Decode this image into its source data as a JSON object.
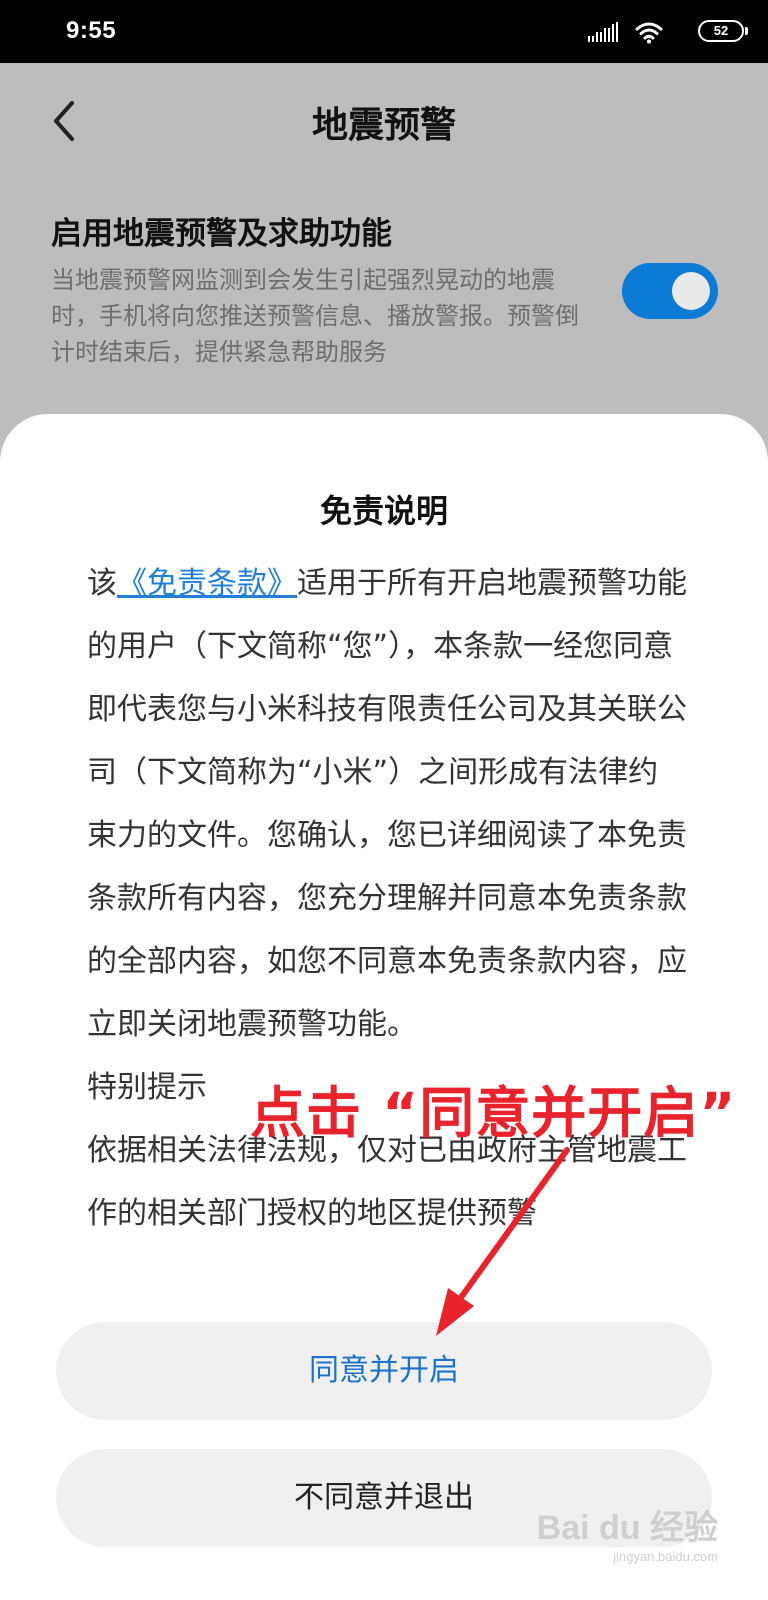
{
  "status_bar": {
    "time": "9:55",
    "battery": "52",
    "icons": [
      "signal-icon",
      "wifi-icon",
      "battery-icon"
    ]
  },
  "header": {
    "back_icon": "chevron-left-icon",
    "title": "地震预警"
  },
  "setting": {
    "title": "启用地震预警及求助功能",
    "description": "当地震预警网监测到会发生引起强烈晃动的地震时，手机将向您推送预警信息、播放警报。预警倒计时结束后，提供紧急帮助服务",
    "toggle_on": true,
    "toggle_color": "#0c7bd6"
  },
  "dialog": {
    "title": "免责说明",
    "para1_prefix": "该",
    "para1_link": "《免责条款》",
    "para1_rest": "适用于所有开启地震预警功能的用户（下文简称“您”），本条款一经您同意即代表您与小米科技有限责任公司及其关联公司（下文简称为“小米”）之间形成有法律约束力的文件。您确认，您已详细阅读了本免责条款所有内容，您充分理解并同意本免责条款的全部内容，如您不同意本免责条款内容，应立即关闭地震预警功能。",
    "para2": "特别提示",
    "para3": "依据相关法律法规，仅对已由政府主管地震工作的相关部门授权的地区提供预警",
    "agree_button": "同意并开启",
    "exit_button": "不同意并退出",
    "link_color": "#1f7fd8"
  },
  "annotation": {
    "text": "点击 “同意并开启”",
    "color": "#e8232c"
  },
  "watermark": {
    "brand": "Bai du 经验",
    "url": "jingyan.baidu.com"
  }
}
